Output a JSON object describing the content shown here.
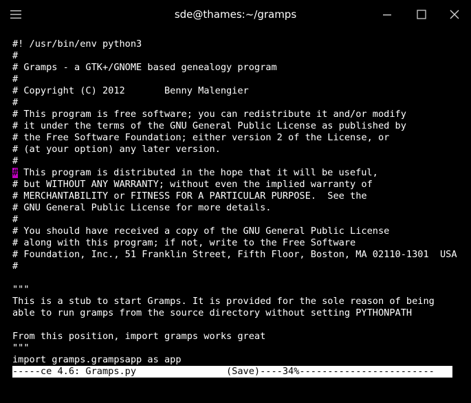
{
  "window": {
    "title": "sde@thames:~/gramps"
  },
  "colors": {
    "background": "#000000",
    "text": "#ffffff",
    "cursor": "#c000c0",
    "modeline_bg": "#ffffff",
    "modeline_fg": "#000000"
  },
  "icons": {
    "menu": "hamburger-menu-icon",
    "minimize": "minimize-icon",
    "maximize": "maximize-icon",
    "close": "close-icon"
  },
  "editor": {
    "lines": [
      "#! /usr/bin/env python3",
      "#",
      "# Gramps - a GTK+/GNOME based genealogy program",
      "#",
      "# Copyright (C) 2012       Benny Malengier",
      "#",
      "# This program is free software; you can redistribute it and/or modify",
      "# it under the terms of the GNU General Public License as published by",
      "# the Free Software Foundation; either version 2 of the License, or",
      "# (at your option) any later version.",
      "#",
      "# This program is distributed in the hope that it will be useful,",
      "# but WITHOUT ANY WARRANTY; without even the implied warranty of",
      "# MERCHANTABILITY or FITNESS FOR A PARTICULAR PURPOSE.  See the",
      "# GNU General Public License for more details.",
      "#",
      "# You should have received a copy of the GNU General Public License",
      "# along with this program; if not, write to the Free Software",
      "# Foundation, Inc., 51 Franklin Street, Fifth Floor, Boston, MA 02110-1301  USA",
      "#",
      "",
      "\"\"\"",
      "This is a stub to start Gramps. It is provided for the sole reason of being",
      "able to run gramps from the source directory without setting PYTHONPATH",
      "",
      "From this position, import gramps works great",
      "\"\"\"",
      "import gramps.grampsapp as app"
    ],
    "cursor_line": 11
  },
  "modeline": {
    "text": "-----ce 4.6: Gramps.py                (Save)----34%------------------------"
  }
}
